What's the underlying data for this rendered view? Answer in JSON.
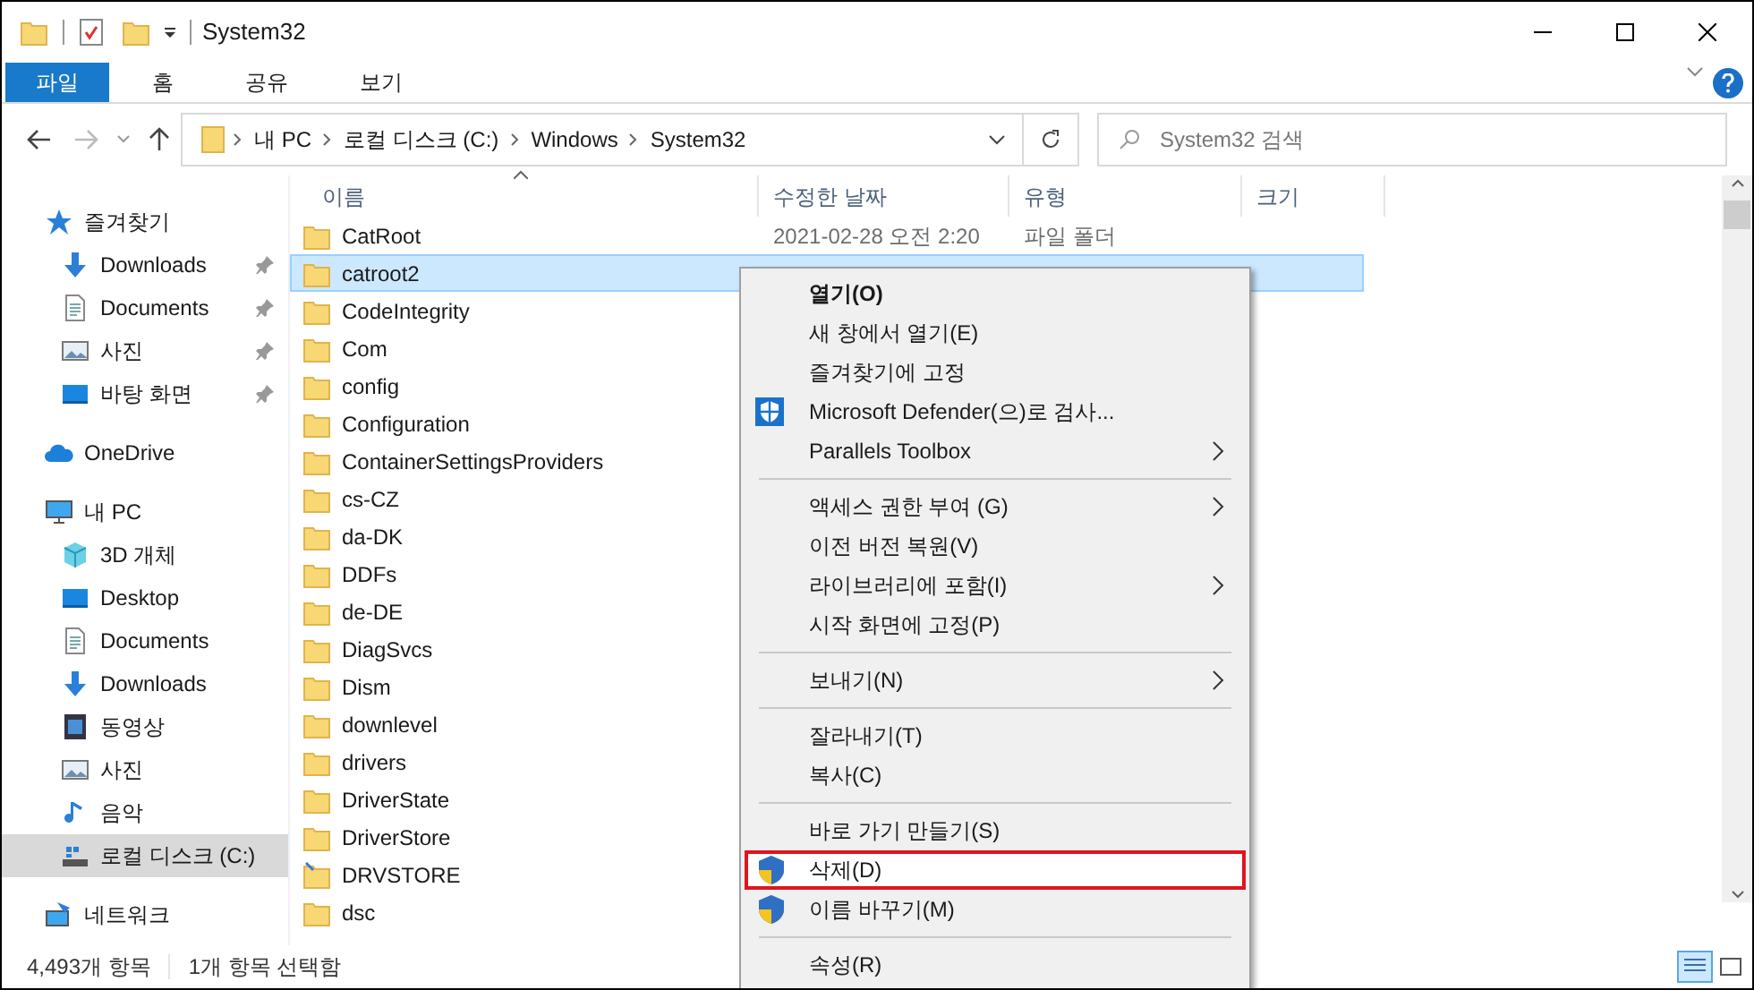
{
  "window": {
    "title": "System32"
  },
  "ribbon_tabs": [
    {
      "label": "파일",
      "selected": true
    },
    {
      "label": "홈",
      "selected": false
    },
    {
      "label": "공유",
      "selected": false
    },
    {
      "label": "보기",
      "selected": false
    }
  ],
  "address": {
    "crumbs": [
      "내 PC",
      "로컬 디스크 (C:)",
      "Windows",
      "System32"
    ]
  },
  "search": {
    "placeholder": "System32 검색"
  },
  "columns": [
    "이름",
    "수정한 날짜",
    "유형",
    "크기"
  ],
  "sidebar": [
    {
      "label": "즐겨찾기",
      "kind": "star",
      "selected": false,
      "children": [
        {
          "label": "Downloads",
          "kind": "download",
          "pinned": true,
          "selected": false
        },
        {
          "label": "Documents",
          "kind": "document",
          "pinned": true,
          "selected": false
        },
        {
          "label": "사진",
          "kind": "picture",
          "pinned": true,
          "selected": false
        },
        {
          "label": "바탕 화면",
          "kind": "desktop",
          "pinned": true,
          "selected": false
        }
      ]
    },
    {
      "label": "OneDrive",
      "kind": "cloud",
      "selected": false
    },
    {
      "label": "내 PC",
      "kind": "pc",
      "selected": false,
      "children": [
        {
          "label": "3D 개체",
          "kind": "cube",
          "pinned": false,
          "selected": false
        },
        {
          "label": "Desktop",
          "kind": "desktop",
          "pinned": false,
          "selected": false
        },
        {
          "label": "Documents",
          "kind": "document",
          "pinned": false,
          "selected": false
        },
        {
          "label": "Downloads",
          "kind": "download",
          "pinned": false,
          "selected": false
        },
        {
          "label": "동영상",
          "kind": "video",
          "pinned": false,
          "selected": false
        },
        {
          "label": "사진",
          "kind": "picture",
          "pinned": false,
          "selected": false
        },
        {
          "label": "음악",
          "kind": "music",
          "pinned": false,
          "selected": false
        },
        {
          "label": "로컬 디스크 (C:)",
          "kind": "drive",
          "pinned": false,
          "selected": true
        }
      ]
    },
    {
      "label": "네트워크",
      "kind": "network",
      "selected": false
    }
  ],
  "files": [
    {
      "name": "CatRoot",
      "kind": "folder",
      "date": "2021-02-28 오전 2:20",
      "type": "파일 폴더",
      "selected": false
    },
    {
      "name": "catroot2",
      "kind": "folder",
      "selected": true
    },
    {
      "name": "CodeIntegrity",
      "kind": "folder",
      "selected": false
    },
    {
      "name": "Com",
      "kind": "folder",
      "selected": false
    },
    {
      "name": "config",
      "kind": "folder",
      "selected": false
    },
    {
      "name": "Configuration",
      "kind": "folder",
      "selected": false
    },
    {
      "name": "ContainerSettingsProviders",
      "kind": "folder",
      "selected": false
    },
    {
      "name": "cs-CZ",
      "kind": "folder",
      "selected": false
    },
    {
      "name": "da-DK",
      "kind": "folder",
      "selected": false
    },
    {
      "name": "DDFs",
      "kind": "folder",
      "selected": false
    },
    {
      "name": "de-DE",
      "kind": "folder",
      "selected": false
    },
    {
      "name": "DiagSvcs",
      "kind": "folder",
      "selected": false
    },
    {
      "name": "Dism",
      "kind": "folder",
      "selected": false
    },
    {
      "name": "downlevel",
      "kind": "folder",
      "selected": false
    },
    {
      "name": "drivers",
      "kind": "folder",
      "selected": false
    },
    {
      "name": "DriverState",
      "kind": "folder",
      "selected": false
    },
    {
      "name": "DriverStore",
      "kind": "folder",
      "selected": false
    },
    {
      "name": "DRVSTORE",
      "kind": "link",
      "selected": false
    },
    {
      "name": "dsc",
      "kind": "folder",
      "selected": false
    }
  ],
  "context_menu": [
    {
      "kind": "item",
      "label": "열기(O)",
      "default": true,
      "submenu": false,
      "highlighted": false
    },
    {
      "kind": "item",
      "label": "새 창에서 열기(E)",
      "default": false,
      "submenu": false,
      "highlighted": false
    },
    {
      "kind": "item",
      "label": "즐겨찾기에 고정",
      "default": false,
      "submenu": false,
      "highlighted": false
    },
    {
      "kind": "defender-item",
      "label": "Microsoft Defender(으)로 검사...",
      "default": false,
      "submenu": false,
      "highlighted": false
    },
    {
      "kind": "item",
      "label": "Parallels Toolbox",
      "default": false,
      "submenu": true,
      "highlighted": false
    },
    {
      "kind": "separator"
    },
    {
      "kind": "item",
      "label": "액세스 권한 부여 (G)",
      "default": false,
      "submenu": true,
      "highlighted": false
    },
    {
      "kind": "item",
      "label": "이전 버전 복원(V)",
      "default": false,
      "submenu": false,
      "highlighted": false
    },
    {
      "kind": "item",
      "label": "라이브러리에 포함(I)",
      "default": false,
      "submenu": true,
      "highlighted": false
    },
    {
      "kind": "item",
      "label": "시작 화면에 고정(P)",
      "default": false,
      "submenu": false,
      "highlighted": false
    },
    {
      "kind": "separator"
    },
    {
      "kind": "item",
      "label": "보내기(N)",
      "default": false,
      "submenu": true,
      "highlighted": false
    },
    {
      "kind": "separator"
    },
    {
      "kind": "item",
      "label": "잘라내기(T)",
      "default": false,
      "submenu": false,
      "highlighted": false
    },
    {
      "kind": "item",
      "label": "복사(C)",
      "default": false,
      "submenu": false,
      "highlighted": false
    },
    {
      "kind": "separator"
    },
    {
      "kind": "item",
      "label": "바로 가기 만들기(S)",
      "default": false,
      "submenu": false,
      "highlighted": false
    },
    {
      "kind": "admin-item",
      "label": "삭제(D)",
      "default": false,
      "submenu": false,
      "highlighted": true
    },
    {
      "kind": "admin-item",
      "label": "이름 바꾸기(M)",
      "default": false,
      "submenu": false,
      "highlighted": false
    },
    {
      "kind": "separator"
    },
    {
      "kind": "item",
      "label": "속성(R)",
      "default": false,
      "submenu": false,
      "highlighted": false
    }
  ],
  "status_bar": {
    "count": "4,493개 항목",
    "selection": "1개 항목 선택함"
  }
}
